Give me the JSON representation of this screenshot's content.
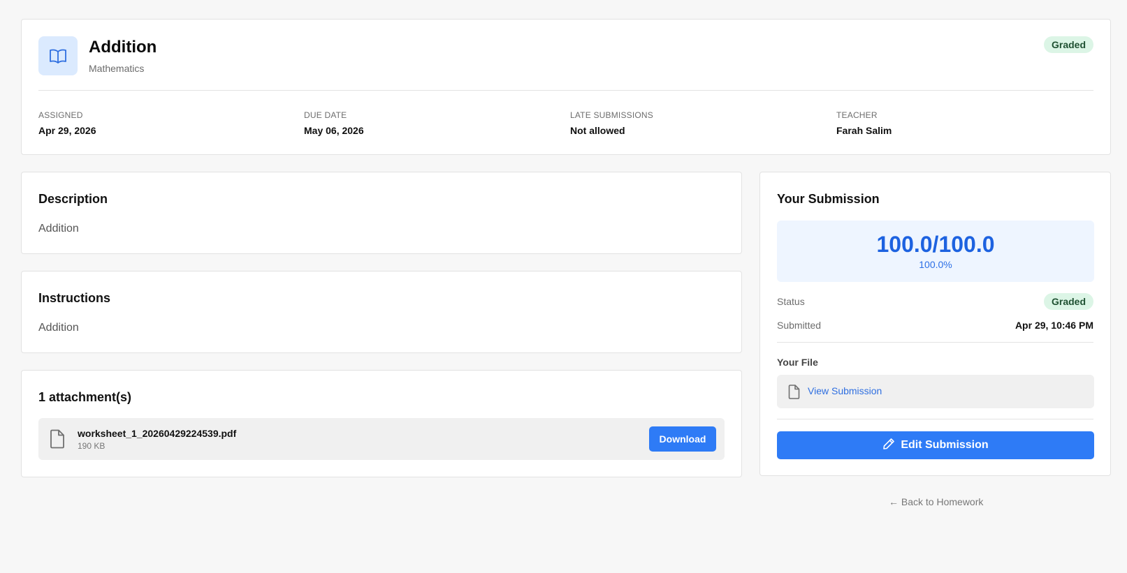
{
  "homework": {
    "title": "Addition",
    "subject": "Mathematics",
    "status_badge": "Graded",
    "book_icon": "book-open-icon"
  },
  "meta": [
    {
      "label": "ASSIGNED",
      "value": "Apr 29, 2026"
    },
    {
      "label": "DUE DATE",
      "value": "May 06, 2026"
    },
    {
      "label": "LATE SUBMISSIONS",
      "value": "Not allowed"
    },
    {
      "label": "TEACHER",
      "value": "Farah Salim"
    }
  ],
  "description": {
    "title": "Description",
    "body": "Addition"
  },
  "instructions": {
    "title": "Instructions",
    "body": "Addition"
  },
  "attachments": {
    "title": "1 attachment(s)",
    "items": [
      {
        "name": "worksheet_1_20260429224539.pdf",
        "size": "190 KB",
        "download_label": "Download",
        "icon": "file-icon"
      }
    ]
  },
  "submission": {
    "title": "Your Submission",
    "score": "100.0/100.0",
    "percent": "100.0%",
    "status_label": "Status",
    "status_badge": "Graded",
    "submitted_label": "Submitted",
    "submitted_value": "Apr 29, 10:46 PM",
    "your_file_label": "Your File",
    "view_label": "View Submission",
    "edit_label": "Edit Submission"
  },
  "back_link": "← Back to Homework",
  "colors": {
    "accent": "#2e7bf6",
    "badge_bg": "#dcf5e6",
    "badge_text": "#1f5132",
    "score_bg": "#eef5ff"
  }
}
